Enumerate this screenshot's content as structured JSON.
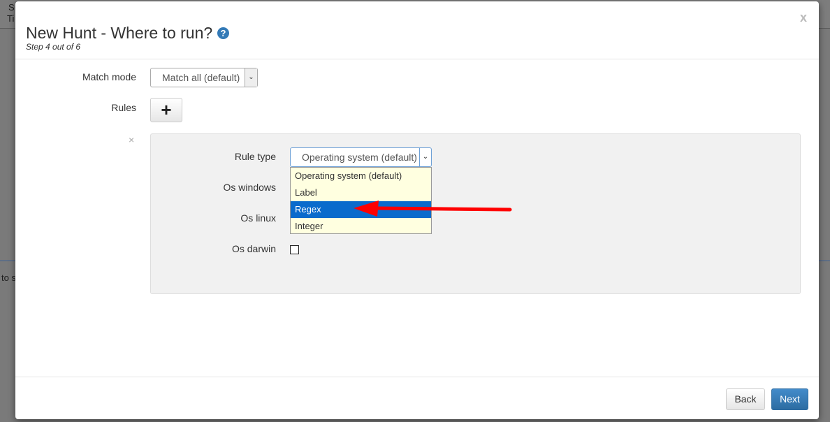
{
  "background": {
    "fragment_top_1": "S",
    "fragment_top_2": "Ti",
    "fragment_left": "to s"
  },
  "modal": {
    "title": "New Hunt - Where to run?",
    "help_icon": "?",
    "step_text": "Step 4 out of 6",
    "close_label": "x"
  },
  "form": {
    "match_mode_label": "Match mode",
    "match_mode_value": "Match all (default)",
    "rules_label": "Rules",
    "add_rule_icon": "+",
    "remove_rule_icon": "×"
  },
  "rule": {
    "rule_type_label": "Rule type",
    "rule_type_value": "Operating system (default)",
    "options": [
      "Operating system (default)",
      "Label",
      "Regex",
      "Integer"
    ],
    "selected_option": "Regex",
    "os_windows_label": "Os windows",
    "os_linux_label": "Os linux",
    "os_darwin_label": "Os darwin",
    "os_darwin_checked": false
  },
  "footer": {
    "back_label": "Back",
    "next_label": "Next"
  },
  "colors": {
    "primary": "#337ab7",
    "highlight": "#0a6bcc",
    "dropdown_bg": "#ffffe0",
    "arrow_annotation": "#ff0000"
  },
  "icons": [
    "help-icon",
    "close-icon",
    "plus-icon",
    "remove-icon",
    "chevron-down-icon",
    "red-arrow-annotation"
  ]
}
